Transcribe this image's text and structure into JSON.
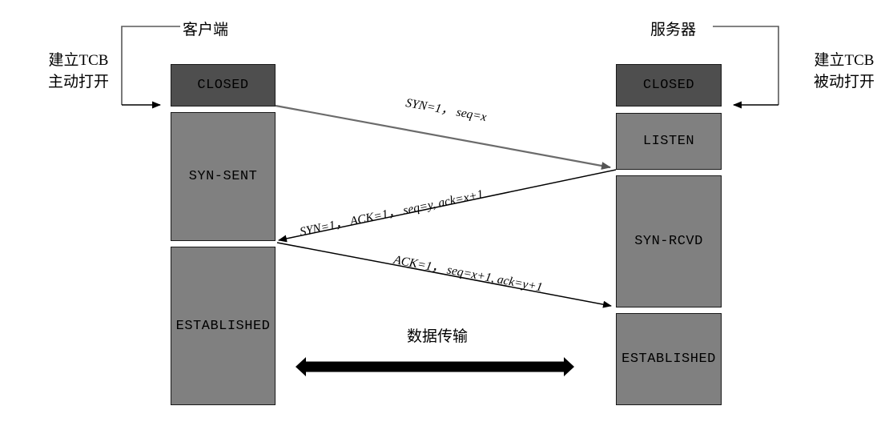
{
  "diagram": {
    "title_client": "客户端",
    "title_server": "服务器",
    "data_transfer_label": "数据传输"
  },
  "notes": {
    "client": {
      "line1": "建立TCB",
      "line2": "主动打开"
    },
    "server": {
      "line1": "建立TCB",
      "line2": "被动打开"
    }
  },
  "client_states": [
    {
      "label": "CLOSED",
      "kind": "closed"
    },
    {
      "label": "SYN-SENT",
      "kind": "open"
    },
    {
      "label": "ESTABLISHED",
      "kind": "open"
    }
  ],
  "server_states": [
    {
      "label": "CLOSED",
      "kind": "closed"
    },
    {
      "label": "LISTEN",
      "kind": "open"
    },
    {
      "label": "SYN-RCVD",
      "kind": "open"
    },
    {
      "label": "ESTABLISHED",
      "kind": "open"
    }
  ],
  "messages": [
    {
      "id": "syn",
      "text": "SYN=1， seq=x",
      "direction": "client-to-server"
    },
    {
      "id": "syn-ack",
      "text": "SYN=1， ACK=1， seq=y, ack=x+1",
      "direction": "server-to-client"
    },
    {
      "id": "ack",
      "text": "ACK=1， seq=x+1, ack=y+1",
      "direction": "client-to-server"
    }
  ],
  "colors": {
    "closed_fill": "#4e4e4e",
    "open_fill": "#808080",
    "border": "#1a1a1a",
    "syn_arrow": "#666666",
    "arrow": "#000000",
    "background": "#ffffff"
  }
}
